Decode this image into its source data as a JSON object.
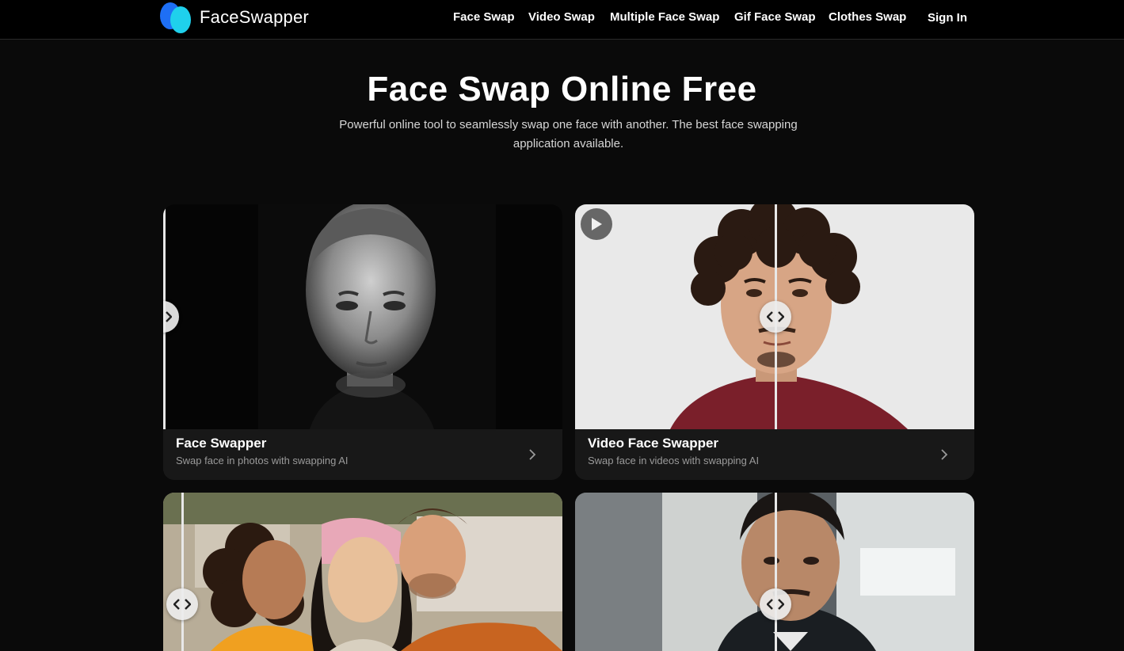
{
  "brand": {
    "name": "FaceSwapper",
    "logo_icon": "two-circle-logo-icon"
  },
  "nav": {
    "items": [
      "Face Swap",
      "Video Swap",
      "Multiple Face Swap",
      "Gif Face Swap",
      "Clothes Swap"
    ],
    "sign_in": "Sign In"
  },
  "hero": {
    "title": "Face Swap Online Free",
    "subtitle": "Powerful online tool to seamlessly swap one face with another. The best face swapping application available."
  },
  "cards": [
    {
      "title": "Face Swapper",
      "description": "Swap face in photos with swapping AI"
    },
    {
      "title": "Video Face Swapper",
      "description": "Swap face in videos with swapping AI"
    },
    {
      "title": "",
      "description": ""
    },
    {
      "title": "",
      "description": ""
    }
  ],
  "colors": {
    "background": "#0a0a0a",
    "topbar": "#000000",
    "card_footer": "#181818",
    "brand_blue": "#1e6ff5",
    "brand_cyan": "#1fd0ec"
  }
}
